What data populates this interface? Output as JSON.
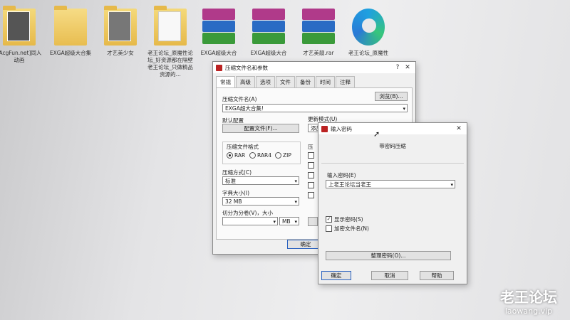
{
  "desktop": {
    "icons": [
      {
        "label": "[AcgFun.net]同人动画",
        "kind": "folder"
      },
      {
        "label": "EXGA超级大合集",
        "kind": "folder"
      },
      {
        "label": "才艺美少女",
        "kind": "folder"
      },
      {
        "label": "老王论坛_原魔性论坛_好资源都在隔壁老王论坛_只做精品资源的...",
        "kind": "folder"
      },
      {
        "label": "EXGA超级大合",
        "kind": "rar"
      },
      {
        "label": "EXGA超级大合",
        "kind": "rar"
      },
      {
        "label": "才艺美靓.rar",
        "kind": "rar"
      },
      {
        "label": "老王论坛_原魔性",
        "kind": "edge"
      }
    ]
  },
  "main_dialog": {
    "title": "压缩文件名和参数",
    "tabs": [
      "常规",
      "高级",
      "选项",
      "文件",
      "备份",
      "时间",
      "注释"
    ],
    "archive_name_label": "压缩文件名(A)",
    "browse_button": "浏览(B)...",
    "archive_name_value": "EXGA超大合集!",
    "default_profile_label": "默认配置",
    "profiles_button": "配置文件(F)...",
    "update_mode_label": "更新模式(U)",
    "update_mode_value": "添加",
    "format_label": "压缩文件格式",
    "formats": [
      "RAR",
      "RAR4",
      "ZIP"
    ],
    "method_label": "压缩方式(C)",
    "method_value": "标准",
    "dict_label": "字典大小(I)",
    "dict_value": "32 MB",
    "split_label": "切分为分卷(V)，大小",
    "split_unit": "MB",
    "options_label": "压",
    "ok_button": "确定"
  },
  "password_dialog": {
    "title": "输入密码",
    "heading": "带密码压缩",
    "enter_label": "输入密码(E)",
    "password_value": "上老王论坛当老王",
    "show_password_label": "显示密码(S)",
    "show_password_checked": true,
    "encrypt_names_label": "加密文件名(N)",
    "encrypt_names_checked": false,
    "organize_button": "整理密码(O)...",
    "ok_button": "确定",
    "cancel_button": "取消",
    "help_button": "帮助"
  },
  "watermark": {
    "title": "老王论坛",
    "url": "laowang.vip"
  }
}
